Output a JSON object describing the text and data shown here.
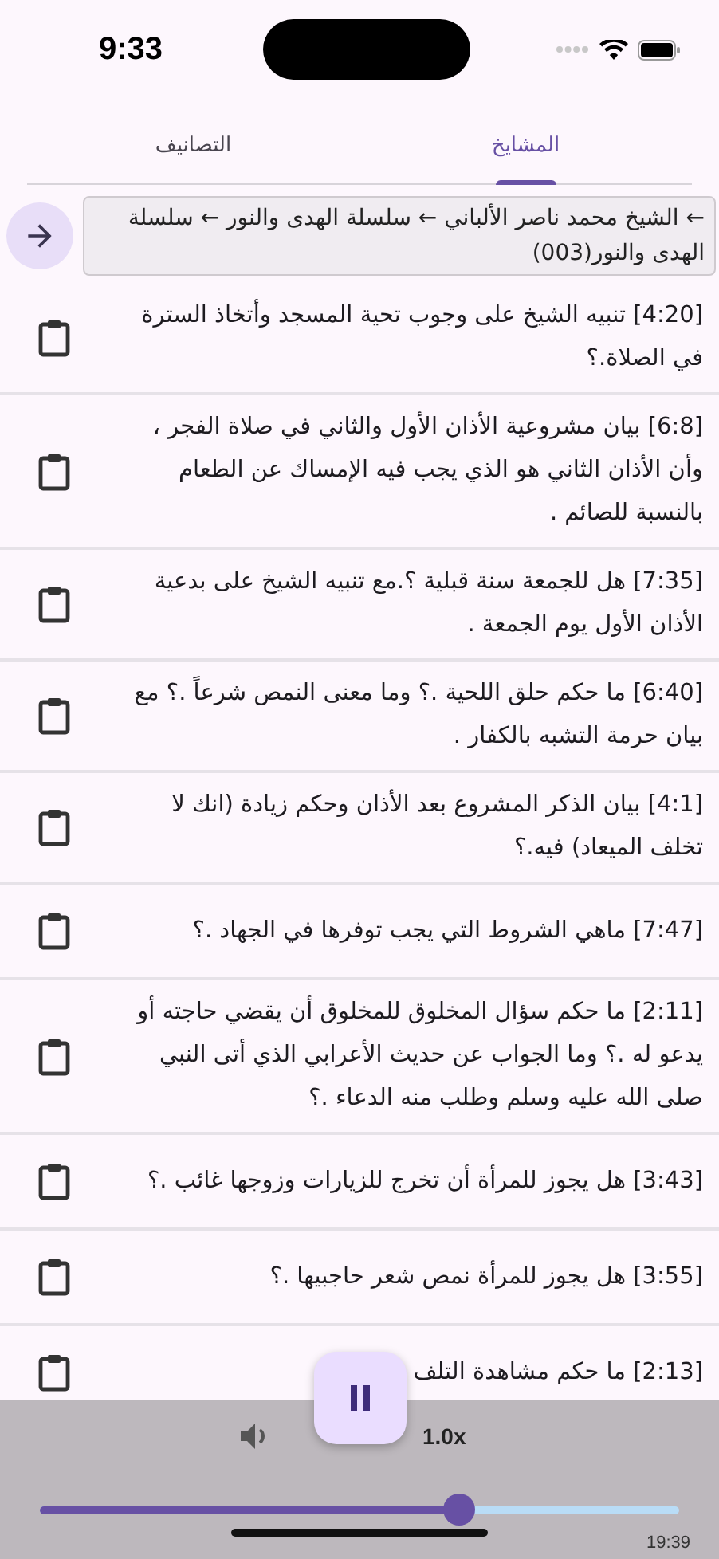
{
  "status_bar": {
    "time": "9:33"
  },
  "tabs": [
    {
      "label": "المشايخ",
      "selected": true
    },
    {
      "label": "التصانيف",
      "selected": false
    }
  ],
  "breadcrumb": "← الشيخ محمد ناصر الألباني ← سلسلة الهدى والنور ← سلسلة الهدى والنور(003)",
  "items": [
    {
      "text": "[4:20] تنبيه الشيخ على وجوب تحية المسجد وأتخاذ السترة في الصلاة.؟"
    },
    {
      "text": "[6:8] بيان مشروعية الأذان الأول والثاني في صلاة الفجر ، وأن الأذان الثاني هو الذي يجب فيه الإمساك عن الطعام بالنسبة للصائم ."
    },
    {
      "text": "[7:35] هل للجمعة سنة قبلية ؟.مع تنبيه الشيخ على بدعية الأذان الأول يوم الجمعة ."
    },
    {
      "text": "[6:40] ما حكم حلق اللحية .؟ وما معنى النمص شرعاً .؟ مع بيان حرمة التشبه بالكفار ."
    },
    {
      "text": "[4:1] بيان الذكر المشروع بعد الأذان وحكم زيادة (انك لا تخلف الميعاد) فيه.؟"
    },
    {
      "text": "[7:47] ماهي الشروط التي يجب توفرها في الجهاد .؟"
    },
    {
      "text": "[2:11] ما حكم سؤال المخلوق للمخلوق أن يقضي حاجته أو يدعو له .؟ وما الجواب عن حديث الأعرابي الذي أتى النبي صلى الله عليه وسلم وطلب منه الدعاء .؟"
    },
    {
      "text": "[3:43] هل يجوز للمرأة أن تخرج للزيارات وزوجها غائب .؟"
    },
    {
      "text": "[3:55] هل يجوز للمرأة نمص شعر حاجبيها .؟"
    },
    {
      "text": "[2:13] ما حكم مشاهدة التلف"
    }
  ],
  "player": {
    "playing": true,
    "speed": "1.0x",
    "level": 0.655,
    "duration": "19:39"
  }
}
